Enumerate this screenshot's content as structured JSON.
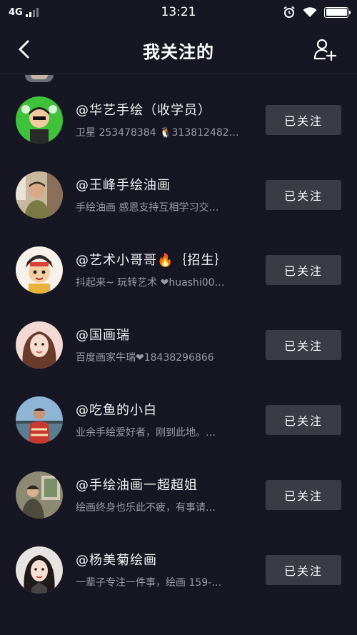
{
  "status_bar": {
    "network": "4G",
    "time": "13:21"
  },
  "nav": {
    "title": "我关注的",
    "back_icon": "chevron-left-icon",
    "add_friend_icon": "add-user-icon"
  },
  "users": [
    {
      "name": "@华艺手绘（收学员）",
      "bio": "卫星 253478384 🐧313812482…",
      "button": "已关注"
    },
    {
      "name": "@王峰手绘油画",
      "bio": "手绘油画 感恩支持互相学习交…",
      "button": "已关注"
    },
    {
      "name": "@艺术小哥哥🔥｛招生｝",
      "bio": "抖起来~ 玩转艺术 ❤huashi00…",
      "button": "已关注"
    },
    {
      "name": "@国画瑞",
      "bio": "百度画家牛瑞❤18438296866",
      "button": "已关注"
    },
    {
      "name": "@吃鱼的小白",
      "bio": "业余手绘爱好者，刚到此地。…",
      "button": "已关注"
    },
    {
      "name": "@手绘油画一超超姐",
      "bio": "绘画终身也乐此不疲，有事请…",
      "button": "已关注"
    },
    {
      "name": "@杨美菊绘画",
      "bio": "一辈子专注一件事，绘画 159-…",
      "button": "已关注"
    }
  ],
  "colors": {
    "background": "#161722",
    "button_bg": "#393b45",
    "secondary_text": "#9a9ba3"
  }
}
